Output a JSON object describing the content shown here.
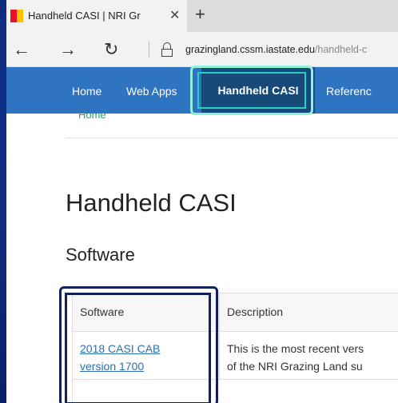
{
  "browser": {
    "tab_title": "Handheld CASI | NRI Gr",
    "tab_close": "✕",
    "new_tab": "+",
    "back": "←",
    "forward": "→",
    "refresh": "↻",
    "url_host": "grazingland.cssm.iastate.edu",
    "url_path": "/handheld-c"
  },
  "site_nav": {
    "items": [
      {
        "label": "Home"
      },
      {
        "label": "Web Apps"
      },
      {
        "label": "Handheld CASI",
        "active": true
      },
      {
        "label": "Referenc"
      }
    ]
  },
  "breadcrumb": "Home",
  "page": {
    "title": "Handheld CASI",
    "section": "Software"
  },
  "table": {
    "headers": [
      "Software",
      "Description"
    ],
    "rows": [
      {
        "software_line1": "2018 CASI CAB",
        "software_line2": "version 1700",
        "description_line1": "This is the most recent vers",
        "description_line2": "of the NRI Grazing Land su"
      }
    ]
  },
  "colors": {
    "nav_bg": "#2f74c0",
    "nav_active": "#174a78",
    "highlight_cyan": "#25d0c4",
    "highlight_navy": "#12205e",
    "link": "#2a6db3"
  }
}
